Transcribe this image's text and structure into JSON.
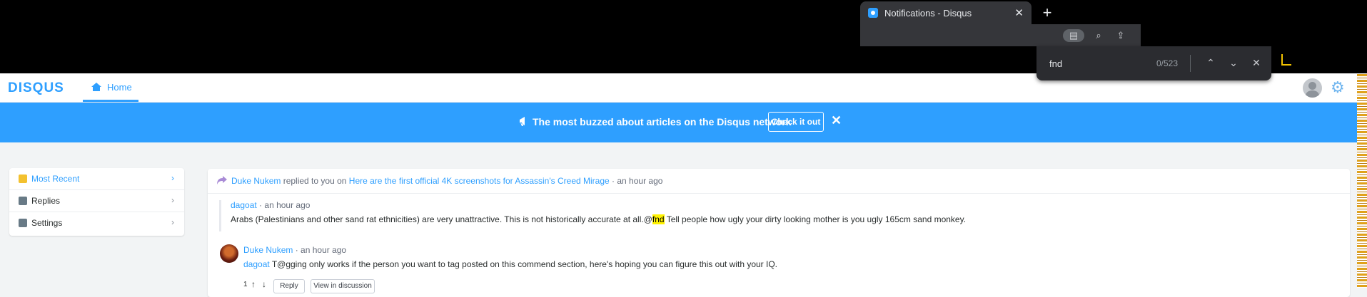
{
  "browser": {
    "tab_title": "Notifications - Disqus",
    "tab_close": "✕",
    "new_tab": "+",
    "find": {
      "query": "fnd",
      "count": "0/523"
    }
  },
  "nav": {
    "logo": "DISQUS",
    "home_label": "Home"
  },
  "banner": {
    "text": "The most buzzed about articles on the Disqus network",
    "cta": "Check it out",
    "close": "✕"
  },
  "sidebar": {
    "items": [
      {
        "label": "Most Recent",
        "chevron": "›",
        "active": true
      },
      {
        "label": "Replies",
        "chevron": "›"
      },
      {
        "label": "Settings",
        "chevron": "›"
      }
    ]
  },
  "notification": {
    "actor": "Duke Nukem",
    "verb": "replied to you on",
    "article": "Here are the first official 4K screenshots for Assassin's Creed Mirage",
    "sep": "·",
    "time": "an hour ago",
    "quoted": {
      "author": "dagoat",
      "time": "an hour ago",
      "text_before": "Arabs (Palestinians and other sand rat ethnicities) are very unattractive. This is not historically accurate at all.@",
      "highlight": "fnd",
      "text_after": " Tell people how ugly your dirty looking mother is you ugly 165cm sand monkey."
    },
    "reply": {
      "author": "Duke Nukem",
      "time": "an hour ago",
      "mention": "dagoat",
      "text": " T@gging only works if the person you want to tag posted on this commend section, here's hoping you can figure this out with your IQ.",
      "votes": "1",
      "reply_btn": "Reply",
      "view_btn": "View in discussion"
    }
  },
  "colors": {
    "brand": "#2e9fff",
    "highlight": "#fff200"
  }
}
